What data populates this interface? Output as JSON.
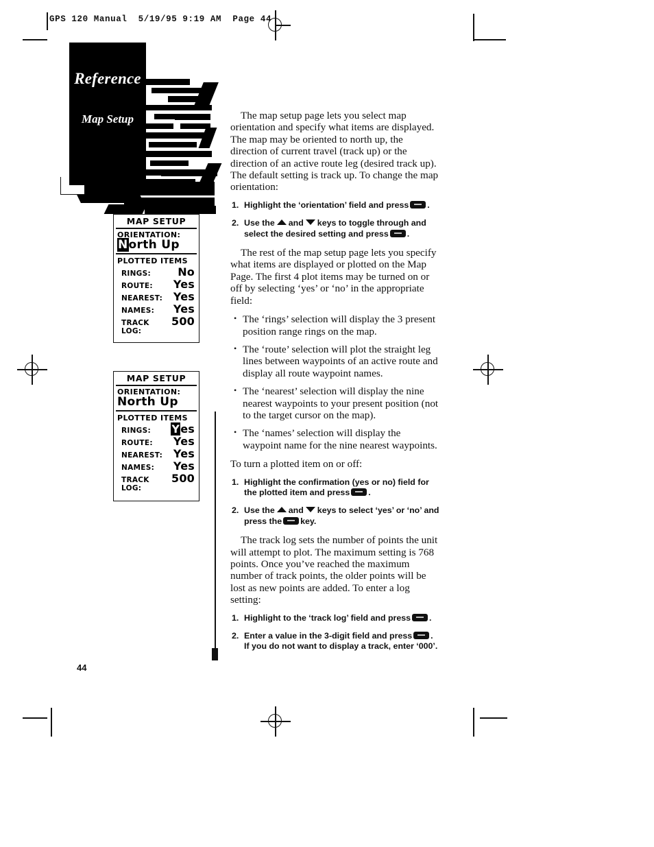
{
  "film_header": {
    "text": "GPS 120 Manual  5/19/95 9:19 AM  Page 44"
  },
  "chapter_tab": {
    "title": "Reference",
    "subtitle": "Map Setup"
  },
  "folio": "44",
  "screens": [
    {
      "name": "map-setup-orientation-highlighted",
      "header": "MAP SETUP",
      "orientation_label": "ORIENTATION:",
      "orientation_value_highlight": "N",
      "orientation_value_rest": "orth Up",
      "section_label": "PLOTTED ITEMS",
      "rows": [
        {
          "key": "RINGS:",
          "value": "No",
          "highlight": ""
        },
        {
          "key": "ROUTE:",
          "value": "Yes",
          "highlight": ""
        },
        {
          "key": "NEAREST:",
          "value": "Yes",
          "highlight": ""
        },
        {
          "key": "NAMES:",
          "value": "Yes",
          "highlight": ""
        },
        {
          "key": "TRACK LOG:",
          "value": "500",
          "highlight": ""
        }
      ]
    },
    {
      "name": "map-setup-rings-highlighted",
      "header": "MAP SETUP",
      "orientation_label": "ORIENTATION:",
      "orientation_value_highlight": "",
      "orientation_value_rest": "North Up",
      "section_label": "PLOTTED ITEMS",
      "rows": [
        {
          "key": "RINGS:",
          "value": "es",
          "highlight": "Y"
        },
        {
          "key": "ROUTE:",
          "value": "Yes",
          "highlight": ""
        },
        {
          "key": "NEAREST:",
          "value": "Yes",
          "highlight": ""
        },
        {
          "key": "NAMES:",
          "value": "Yes",
          "highlight": ""
        },
        {
          "key": "TRACK LOG:",
          "value": "500",
          "highlight": ""
        }
      ]
    }
  ],
  "body": {
    "p1": "The map setup page lets you select map orientation and specify what items are displayed. The map may be oriented to north up, the direction of current travel (track up) or the direction of an active route leg (desired track up). The default setting is track up. To change the map orientation:",
    "steps1": [
      {
        "num": "1.",
        "pre": "Highlight the ‘orientation’ field and press",
        "post": "."
      },
      {
        "num": "2.",
        "pre": "Use the",
        "mid": "and",
        "post": "keys to toggle through and select the desired setting and press",
        "tail": "."
      }
    ],
    "p2": "The rest of the map setup page lets you specify what items are displayed or plotted on the Map Page. The first 4 plot items may be turned on or off by selecting ‘yes’ or ‘no’ in the appropriate field:",
    "bullets": [
      "The ‘rings’ selection will display the 3 present position range rings on the map.",
      "The ‘route’ selection will plot the straight leg lines between waypoints of an active route and display all route waypoint names.",
      "The ‘nearest’ selection will display the nine nearest waypoints to your present position (not to the target cursor on the map).",
      "The ‘names’ selection will display the waypoint name for the nine nearest waypoints."
    ],
    "p3": "To turn a plotted item on or off:",
    "steps2": [
      {
        "num": "1.",
        "pre": "Highlight the confirmation (yes or no) field for the plotted item and press",
        "post": "."
      },
      {
        "num": "2.",
        "pre": "Use the",
        "mid": "and",
        "post": "keys to select ‘yes’ or ‘no’ and press the",
        "tail": "key."
      }
    ],
    "p4": "The track log sets the number of points the unit will attempt to plot. The maximum setting is 768 points. Once you’ve reached the maximum number of track points, the older points will be lost as new points are added. To enter a log setting:",
    "steps3": [
      {
        "num": "1.",
        "pre": "Highlight to the ‘track log’ field and press",
        "post": "."
      },
      {
        "num": "2.",
        "pre": "Enter a value in the 3-digit field and press",
        "post": ". If you do not want to display a track, enter ‘000’."
      }
    ]
  },
  "colors": {
    "ink": "#111111",
    "paper": "#ffffff",
    "tab_block": "#000000"
  }
}
